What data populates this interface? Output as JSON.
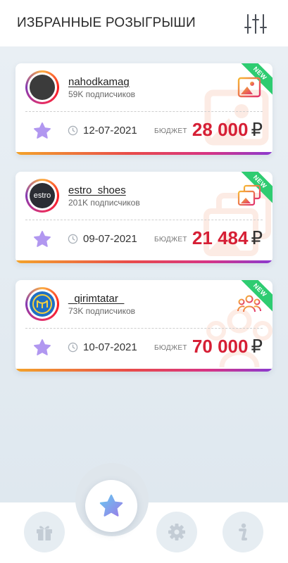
{
  "header": {
    "title": "ИЗБРАННЫЕ РОЗЫГРЫШИ",
    "filter_icon": "sliders-icon"
  },
  "labels": {
    "budget": "БЮДЖЕТ",
    "new_badge": "NEW",
    "currency": "₽"
  },
  "cards": [
    {
      "username": "nahodkamag",
      "followers": "59K подписчиков",
      "date": "12-07-2021",
      "budget": "28 000",
      "type_icon": "image-icon",
      "is_new": true,
      "favorite": true
    },
    {
      "username": "estro_shoes",
      "followers": "201K подписчиков",
      "avatar_text": "estro",
      "date": "09-07-2021",
      "budget": "21 484",
      "type_icon": "gallery-icon",
      "is_new": true,
      "favorite": true
    },
    {
      "username": "_qirimtatar_",
      "followers": "73K подписчиков",
      "date": "10-07-2021",
      "budget": "70 000",
      "type_icon": "group-icon",
      "is_new": true,
      "favorite": true
    }
  ],
  "nav": {
    "items": [
      "gift-icon",
      "star-icon",
      "gear-icon",
      "info-icon"
    ],
    "active": "star-icon"
  },
  "colors": {
    "accent_red": "#d61f35",
    "star_purple": "#b197f0",
    "new_green": "#2ecc71"
  }
}
